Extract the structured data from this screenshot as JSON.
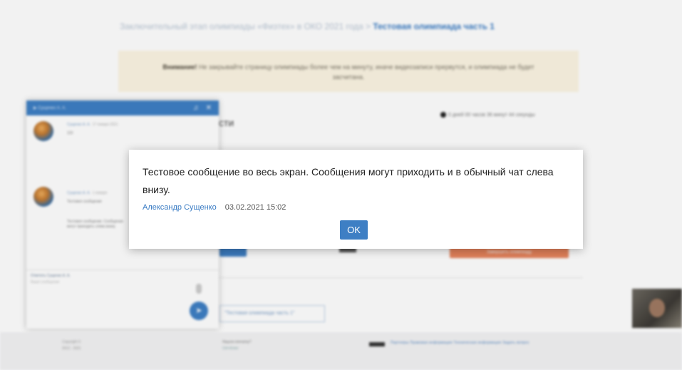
{
  "background": {
    "breadcrumb_path": "Заключительный этап олимпиады «Физтех» в ОКО 2021 года >",
    "breadcrumb_current": "Тестовая олимпиада часть 1",
    "warning_bold": "Внимание!",
    "warning_text": "Не закрывайте страницу олимпиады более чем на минуту, иначе видеозаписи прервутся, и олимпиада не будет засчитана.",
    "section_title": "сти",
    "timer": "0 дней 00 часов 36 минут 44 секунды",
    "olympiad_link": "\"Тестовая олимпиада часть 1\"",
    "orange_button": "Завершить олимпиаду",
    "footer": {
      "copyright": "Copyright ©",
      "years": "2012 - 2021",
      "question": "Нашли опечатку?",
      "question_sub": "Ctrl+Enter",
      "links": "Партнеры   Правовая информация   Техническая информация   Задать вопрос"
    }
  },
  "chat": {
    "header_name": "Сущенко А. А.",
    "messages": [
      {
        "author": "Сущенко А. А.",
        "time": "17 января 2021",
        "text": "123"
      },
      {
        "author": "Сущенко А. А.",
        "time": "1 января",
        "text": "Тестовое сообщение"
      }
    ],
    "bubble_text": "Тестовое сообщение. Сообщения могут приходить слева внизу.",
    "reply_to": "Ответить Сущенко А. А.",
    "input_placeholder": "Ваше сообщение",
    "send_icon": "send-icon"
  },
  "modal": {
    "message": "Тестовое сообщение во весь экран. Сообщения могут приходить и в обычный чат слева внизу.",
    "author": "Александр Сущенко",
    "date": "03.02.2021 15:02",
    "ok_label": "OK"
  },
  "colors": {
    "accent": "#3e7fc4",
    "warning_bg": "#fcf5e3",
    "orange": "#e8845c"
  }
}
